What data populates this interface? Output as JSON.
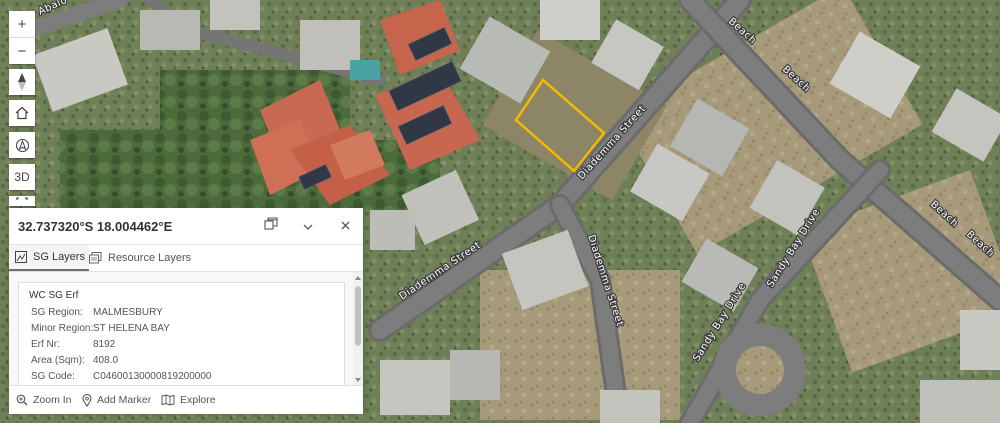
{
  "map": {
    "streets": [
      {
        "id": "abalone",
        "label": "Abalo"
      },
      {
        "id": "diademma-street-north",
        "label": "Diademma Street"
      },
      {
        "id": "diademma-street-west",
        "label": "Diademma Street"
      },
      {
        "id": "diademma-street-south",
        "label": "Diademma Street"
      },
      {
        "id": "beach-1",
        "label": "Beach"
      },
      {
        "id": "beach-2",
        "label": "Beach"
      },
      {
        "id": "beach-3",
        "label": "Beach"
      },
      {
        "id": "beach-4",
        "label": "Beach"
      },
      {
        "id": "sandy-bay-drive-1",
        "label": "Sandy Bay Drive"
      },
      {
        "id": "sandy-bay-drive-2",
        "label": "Sandy Bay Drive"
      }
    ],
    "highlight_color": "#f5b800"
  },
  "toolbar": {
    "zoom_in": "+",
    "zoom_out": "−",
    "compass_icon": "compass-icon",
    "home_icon": "home-icon",
    "locate_icon": "locate-icon",
    "toggle_3d_label": "3D"
  },
  "popup": {
    "coordinates": "32.737320°S 18.004462°E",
    "tabs": [
      {
        "label": "SG Layers",
        "icon": "sg-layers-icon",
        "active": true
      },
      {
        "label": "Resource Layers",
        "icon": "resource-layers-icon",
        "active": false
      }
    ],
    "card": {
      "title": "WC SG Erf",
      "fields": [
        {
          "key": "SG Region:",
          "value": "MALMESBURY"
        },
        {
          "key": "Minor Region:",
          "value": "ST HELENA BAY"
        },
        {
          "key": "Erf Nr:",
          "value": "8192"
        },
        {
          "key": "Area (Sqm):",
          "value": "408.0"
        },
        {
          "key": "SG Code:",
          "value": "C04600130000819200000"
        }
      ]
    },
    "footer": {
      "zoom_in": "Zoom In",
      "add_marker": "Add Marker",
      "explore": "Explore"
    }
  }
}
